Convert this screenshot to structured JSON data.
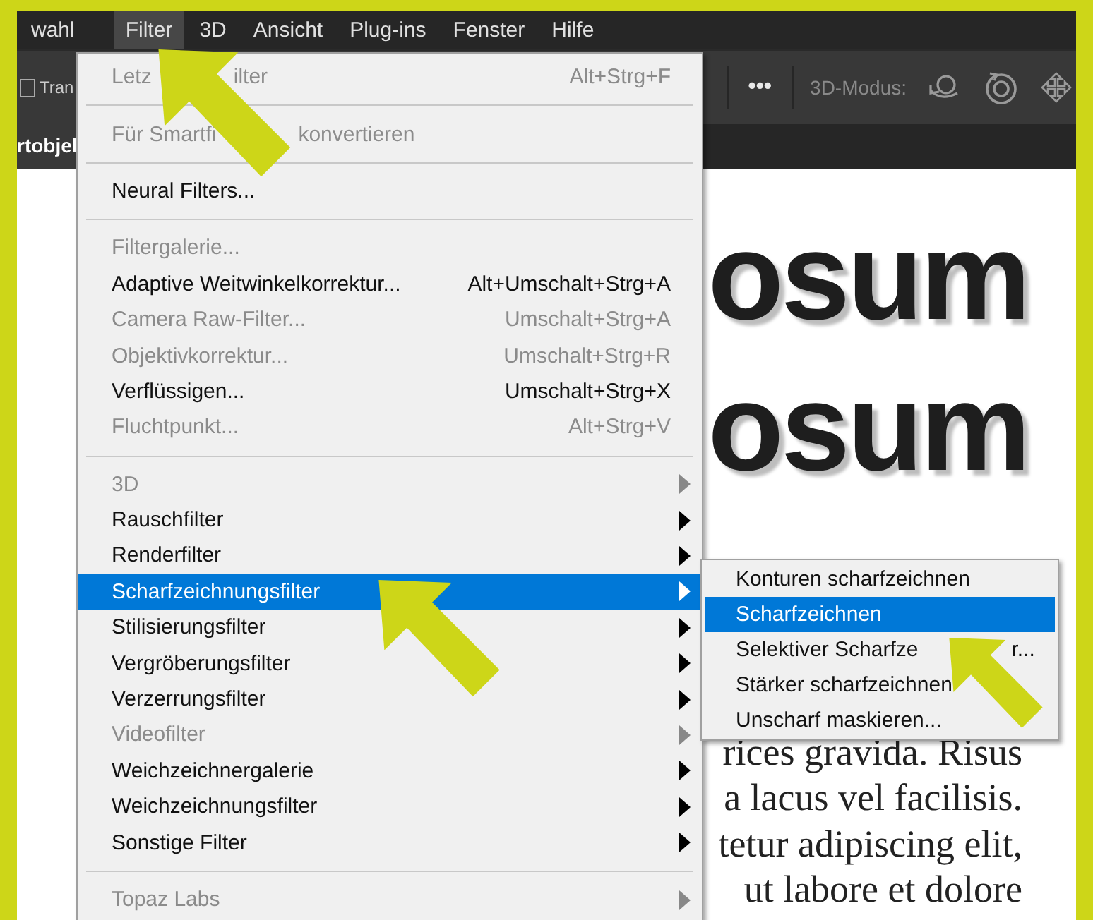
{
  "menubar": [
    {
      "label": "wahl",
      "selected": false
    },
    {
      "label": "Filter",
      "selected": true
    },
    {
      "label": "3D",
      "selected": false
    },
    {
      "label": "Ansicht",
      "selected": false
    },
    {
      "label": "Plug-ins",
      "selected": false
    },
    {
      "label": "Fenster",
      "selected": false
    },
    {
      "label": "Hilfe",
      "selected": false
    }
  ],
  "options_bar": {
    "checkbox": {
      "label": "Tran",
      "checked": false
    },
    "more": "•••",
    "mode_label": "3D-Modus:"
  },
  "document_tab": "rtobjel",
  "canvas": {
    "headings": [
      "osum",
      "osum"
    ],
    "lines": [
      "rices gravida. Risus",
      "a lacus vel facilisis.",
      "tetur adipiscing elit,",
      "ut labore et dolore"
    ]
  },
  "menu": {
    "sections": [
      [
        {
          "label": "Letz",
          "label_rest": "ilter",
          "shortcut": "Alt+Strg+F",
          "disabled": true,
          "has_submenu": false,
          "selected": false
        }
      ],
      [
        {
          "label": "Für Smartfi",
          "label_rest": "konvertieren",
          "disabled": true,
          "has_submenu": false,
          "selected": false
        }
      ],
      [
        {
          "label": "Neural Filters...",
          "disabled": false,
          "has_submenu": false,
          "selected": false
        }
      ],
      [
        {
          "label": "Filtergalerie...",
          "disabled": true,
          "has_submenu": false,
          "selected": false
        },
        {
          "label": "Adaptive Weitwinkelkorrektur...",
          "shortcut": "Alt+Umschalt+Strg+A",
          "disabled": false,
          "has_submenu": false,
          "selected": false
        },
        {
          "label": "Camera Raw-Filter...",
          "shortcut": "Umschalt+Strg+A",
          "disabled": true,
          "has_submenu": false,
          "selected": false
        },
        {
          "label": "Objektivkorrektur...",
          "shortcut": "Umschalt+Strg+R",
          "disabled": true,
          "has_submenu": false,
          "selected": false
        },
        {
          "label": "Verflüssigen...",
          "shortcut": "Umschalt+Strg+X",
          "disabled": false,
          "has_submenu": false,
          "selected": false
        },
        {
          "label": "Fluchtpunkt...",
          "shortcut": "Alt+Strg+V",
          "disabled": true,
          "has_submenu": false,
          "selected": false
        }
      ],
      [
        {
          "label": "3D",
          "disabled": true,
          "has_submenu": true,
          "selected": false
        },
        {
          "label": "Rauschfilter",
          "disabled": false,
          "has_submenu": true,
          "selected": false
        },
        {
          "label": "Renderfilter",
          "disabled": false,
          "has_submenu": true,
          "selected": false
        },
        {
          "label": "Scharfzeichnungsfilter",
          "disabled": false,
          "has_submenu": true,
          "selected": true
        },
        {
          "label": "Stilisierungsfilter",
          "disabled": false,
          "has_submenu": true,
          "selected": false
        },
        {
          "label": "Vergröberungsfilter",
          "disabled": false,
          "has_submenu": true,
          "selected": false
        },
        {
          "label": "Verzerrungsfilter",
          "disabled": false,
          "has_submenu": true,
          "selected": false
        },
        {
          "label": "Videofilter",
          "disabled": true,
          "has_submenu": true,
          "selected": false
        },
        {
          "label": "Weichzeichnergalerie",
          "disabled": false,
          "has_submenu": true,
          "selected": false
        },
        {
          "label": "Weichzeichnungsfilter",
          "disabled": false,
          "has_submenu": true,
          "selected": false
        },
        {
          "label": "Sonstige Filter",
          "disabled": false,
          "has_submenu": true,
          "selected": false
        }
      ],
      [
        {
          "label": "Topaz Labs",
          "disabled": true,
          "has_submenu": true,
          "selected": false
        }
      ]
    ]
  },
  "submenu": [
    {
      "label": "Konturen scharfzeichnen",
      "selected": false
    },
    {
      "label": "Scharfzeichnen",
      "selected": true
    },
    {
      "label": "Selektiver Scharfze",
      "label_rest": "r...",
      "selected": false
    },
    {
      "label": "Stärker scharfzeichnen",
      "selected": false
    },
    {
      "label": "Unscharf maskieren...",
      "selected": false
    }
  ]
}
